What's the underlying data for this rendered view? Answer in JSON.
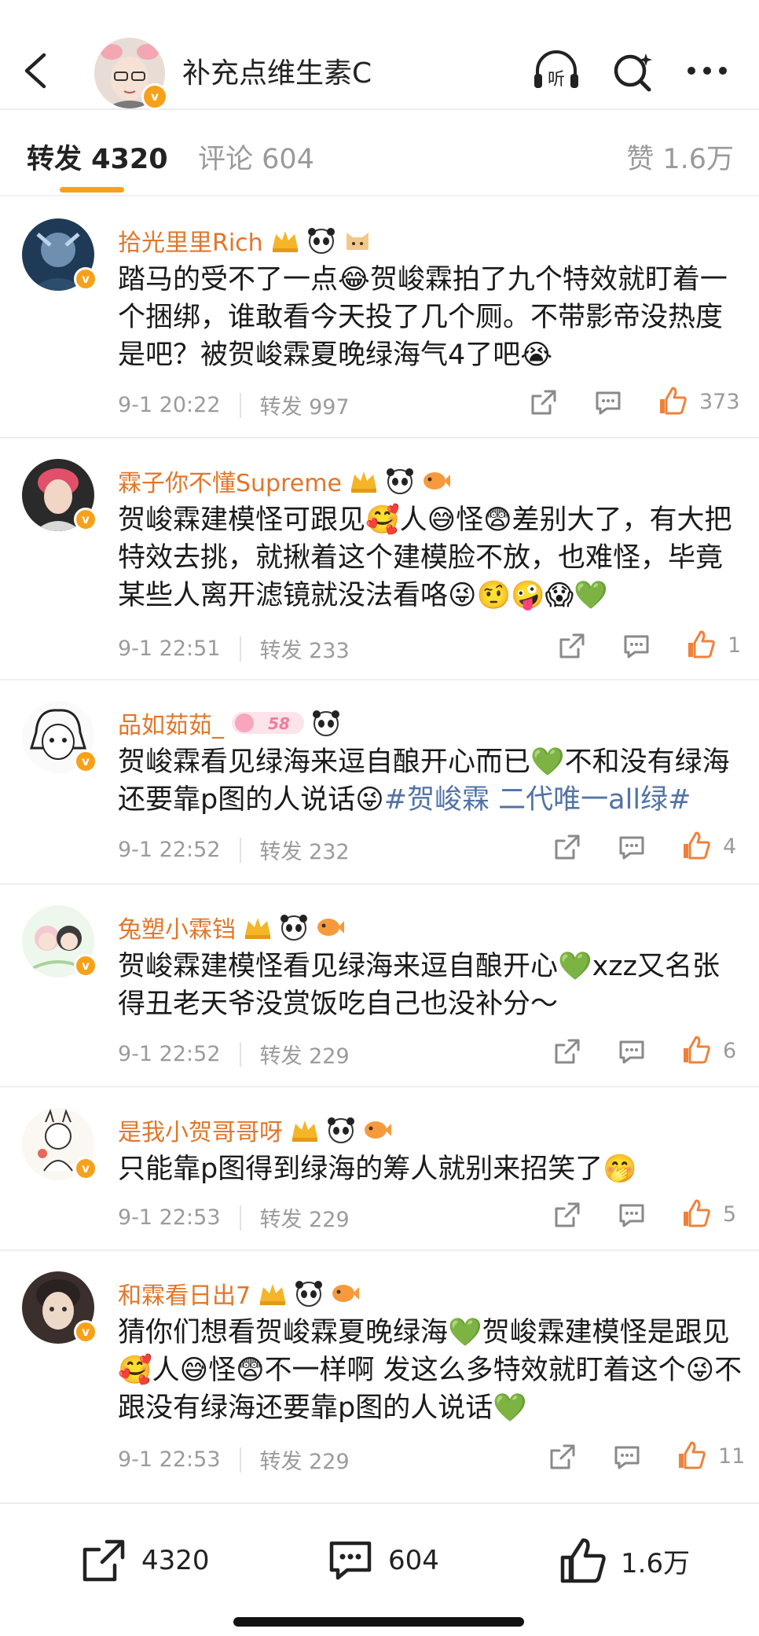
{
  "header": {
    "title": "补充点维生素C",
    "listen_label": "听"
  },
  "tabs": {
    "reposts": "转发 4320",
    "comments": "评论 604",
    "likes": "赞 1.6万"
  },
  "colors": {
    "accent": "#f7a11b",
    "username": "#e2762a",
    "hashtag": "#5273a6",
    "meta": "#9b9b9b"
  },
  "reposts": [
    {
      "username": "拾光里里Rich",
      "medals": [
        "crown-medal",
        "panda-medal",
        "cat-medal"
      ],
      "text": "踏马的受不了一点😂贺峻霖拍了九个特效就盯着一个捆绑，谁敢看今天投了几个厕。不带影帝没热度是吧？被贺峻霖夏晚绿海气4了吧😭",
      "time": "9-1 20:22",
      "repost_label": "转发 997",
      "likes": "373"
    },
    {
      "username": "霖子你不懂Supreme",
      "medals": [
        "crown-medal",
        "panda-medal",
        "fish-medal"
      ],
      "text": "贺峻霖建模怪可跟见🥰人😅怪😨差别大了，有大把特效去挑，就揪着这个建模脸不放，也难怪，毕竟某些人离开滤镜就没法看咯😜🤨🤪😱💚",
      "time": "9-1 22:51",
      "repost_label": "转发 233",
      "likes": "1"
    },
    {
      "username": "品如茹茹_",
      "medals": [
        "level-58-medal",
        "panda-medal"
      ],
      "level_badge": "58",
      "text": "贺峻霖看见绿海来逗自酿开心而已💚不和没有绿海还要靠p图的人说话😜",
      "hashtag": "#贺峻霖 二代唯一all绿#",
      "time": "9-1 22:52",
      "repost_label": "转发 232",
      "likes": "4"
    },
    {
      "username": "兔塑小霖铛",
      "medals": [
        "crown-medal",
        "panda-medal",
        "fish-medal"
      ],
      "text": "贺峻霖建模怪看见绿海来逗自酿开心💚xzz又名张得丑老天爷没赏饭吃自己也没补分～",
      "time": "9-1 22:52",
      "repost_label": "转发 229",
      "likes": "6"
    },
    {
      "username": "是我小贺哥哥呀",
      "medals": [
        "crown-medal",
        "panda-medal",
        "fish-medal"
      ],
      "text": "只能靠p图得到绿海的筹人就别来招笑了🤭",
      "time": "9-1 22:53",
      "repost_label": "转发 229",
      "likes": "5"
    },
    {
      "username": "和霖看日出7",
      "medals": [
        "crown-medal",
        "panda-medal",
        "fish-medal"
      ],
      "text": "猜你们想看贺峻霖夏晚绿海💚贺峻霖建模怪是跟见🥰人😅怪😨不一样啊 发这么多特效就盯着这个😜不跟没有绿海还要靠p图的人说话💚",
      "time": "9-1 22:53",
      "repost_label": "转发 229",
      "likes": "11"
    }
  ],
  "bottom_bar": {
    "reposts": "4320",
    "comments": "604",
    "likes": "1.6万"
  }
}
